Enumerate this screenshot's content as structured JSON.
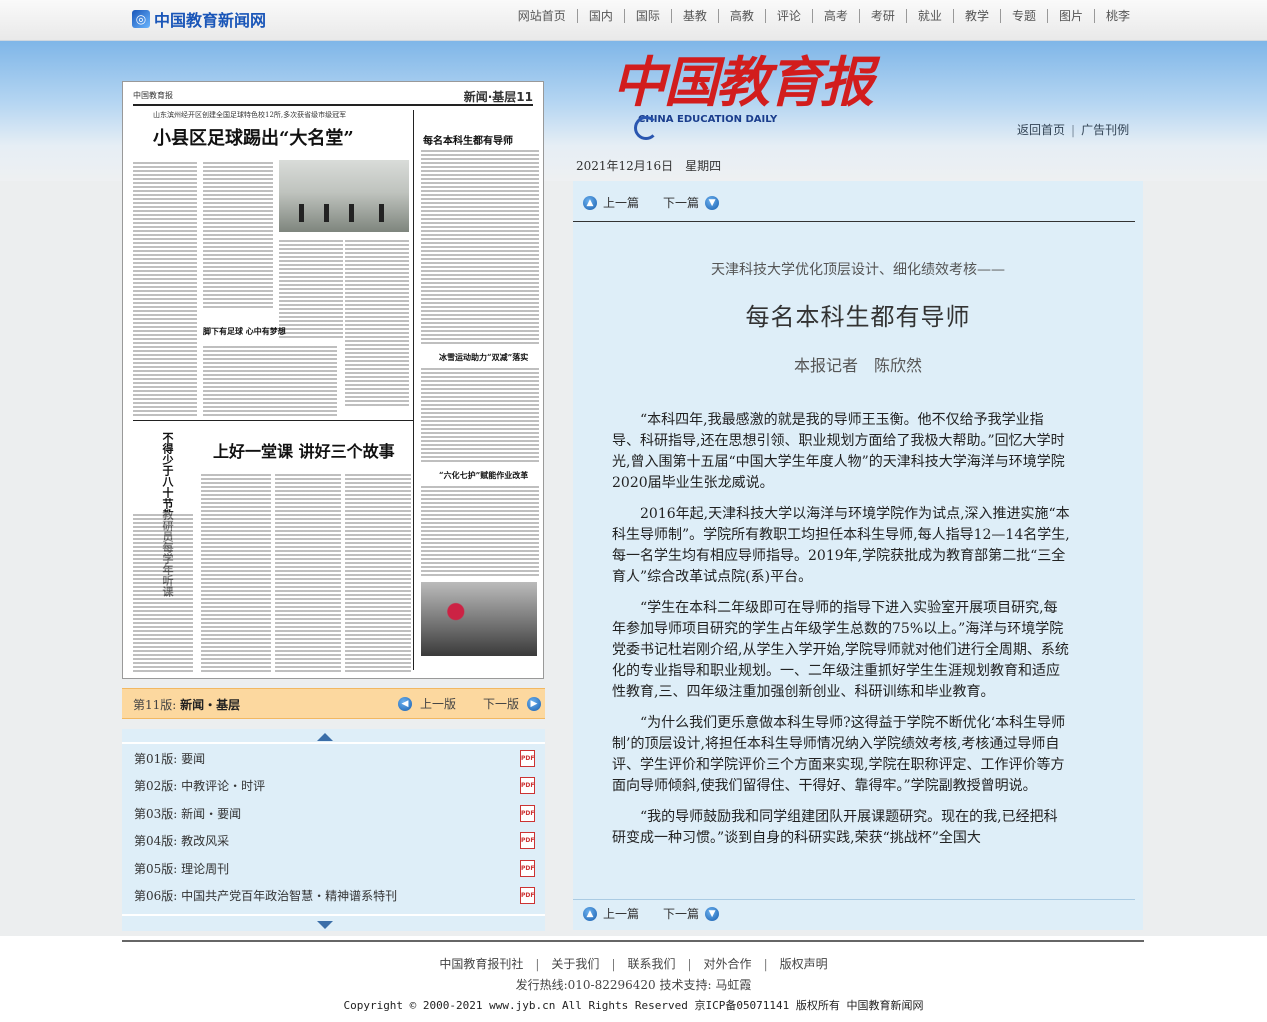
{
  "site": {
    "logo_text": "中国教育新闻网"
  },
  "nav": [
    "网站首页",
    "国内",
    "国际",
    "基教",
    "高教",
    "评论",
    "高考",
    "考研",
    "就业",
    "教学",
    "专题",
    "图片",
    "桃李"
  ],
  "banner": {
    "paper_name_cn": "中国教育报",
    "paper_name_en": "CHINA EDUCATION DAILY",
    "back_home": "返回首页",
    "ad": "广告刊例",
    "date": "2021年12月16日　星期四"
  },
  "newspaper_page": {
    "masthead": "中国教育报",
    "page_label": "新闻·基层11",
    "headline_main": "小县区足球踢出“大名堂”",
    "headline_main_kicker": "山东滨州经开区创建全国足球特色校12所,多次获省级市级冠军",
    "headline_right": "每名本科生都有导师",
    "headline_lower": "上好一堂课 讲好三个故事",
    "headline_small1": "脚下有足球 心中有梦想",
    "headline_small2": "冰雪运动助力“双减”落实",
    "headline_small3": "“六化七护”赋能作业改革",
    "vertical_headline": "不得少于八十节教研员每学年听课"
  },
  "pagebar": {
    "current_prefix": "第11版:",
    "current_name": "新闻・基层",
    "prev_label": "上一版",
    "next_label": "下一版"
  },
  "page_list": [
    {
      "num": "第01版:",
      "name": "要闻"
    },
    {
      "num": "第02版:",
      "name": "中教评论・时评"
    },
    {
      "num": "第03版:",
      "name": "新闻・要闻"
    },
    {
      "num": "第04版:",
      "name": "教改风采"
    },
    {
      "num": "第05版:",
      "name": "理论周刊"
    },
    {
      "num": "第06版:",
      "name": "中国共产党百年政治智慧・精神谱系特刊"
    }
  ],
  "article": {
    "prev_label": "上一篇",
    "next_label": "下一篇",
    "subtitle": "天津科技大学优化顶层设计、细化绩效考核——",
    "title": "每名本科生都有导师",
    "author": "本报记者　陈欣然",
    "paragraphs": [
      "“本科四年,我最感激的就是我的导师王玉衡。他不仅给予我学业指导、科研指导,还在思想引领、职业规划方面给了我极大帮助。”回忆大学时光,曾入围第十五届“中国大学生年度人物”的天津科技大学海洋与环境学院2020届毕业生张龙威说。",
      "2016年起,天津科技大学以海洋与环境学院作为试点,深入推进实施“本科生导师制”。学院所有教职工均担任本科生导师,每人指导12—14名学生,每一名学生均有相应导师指导。2019年,学院获批成为教育部第二批“三全育人”综合改革试点院(系)平台。",
      "“学生在本科二年级即可在导师的指导下进入实验室开展项目研究,每年参加导师项目研究的学生占年级学生总数的75%以上。”海洋与环境学院党委书记杜岩刚介绍,从学生入学开始,学院导师就对他们进行全周期、系统化的专业指导和职业规划。一、二年级注重抓好学生生涯规划教育和适应性教育,三、四年级注重加强创新创业、科研训练和毕业教育。",
      "“为什么我们更乐意做本科生导师?这得益于学院不断优化‘本科生导师制’的顶层设计,将担任本科生导师情况纳入学院绩效考核,考核通过导师自评、学生评价和学院评价三个方面来实现,学院在职称评定、工作评价等方面向导师倾斜,使我们留得住、干得好、靠得牢。”学院副教授曾明说。",
      "“我的导师鼓励我和同学组建团队开展课题研究。现在的我,已经把科研变成一种习惯。”谈到自身的科研实践,荣获“挑战杯”全国大"
    ]
  },
  "footer": {
    "links": [
      "中国教育报刊社",
      "关于我们",
      "联系我们",
      "对外合作",
      "版权声明"
    ],
    "hotline": "发行热线:010-82296420 技术支持: 马虹霞",
    "copyright": "Copyright © 2000-2021 www.jyb.cn All Rights Reserved 京ICP备05071141 版权所有 中国教育新闻网"
  }
}
